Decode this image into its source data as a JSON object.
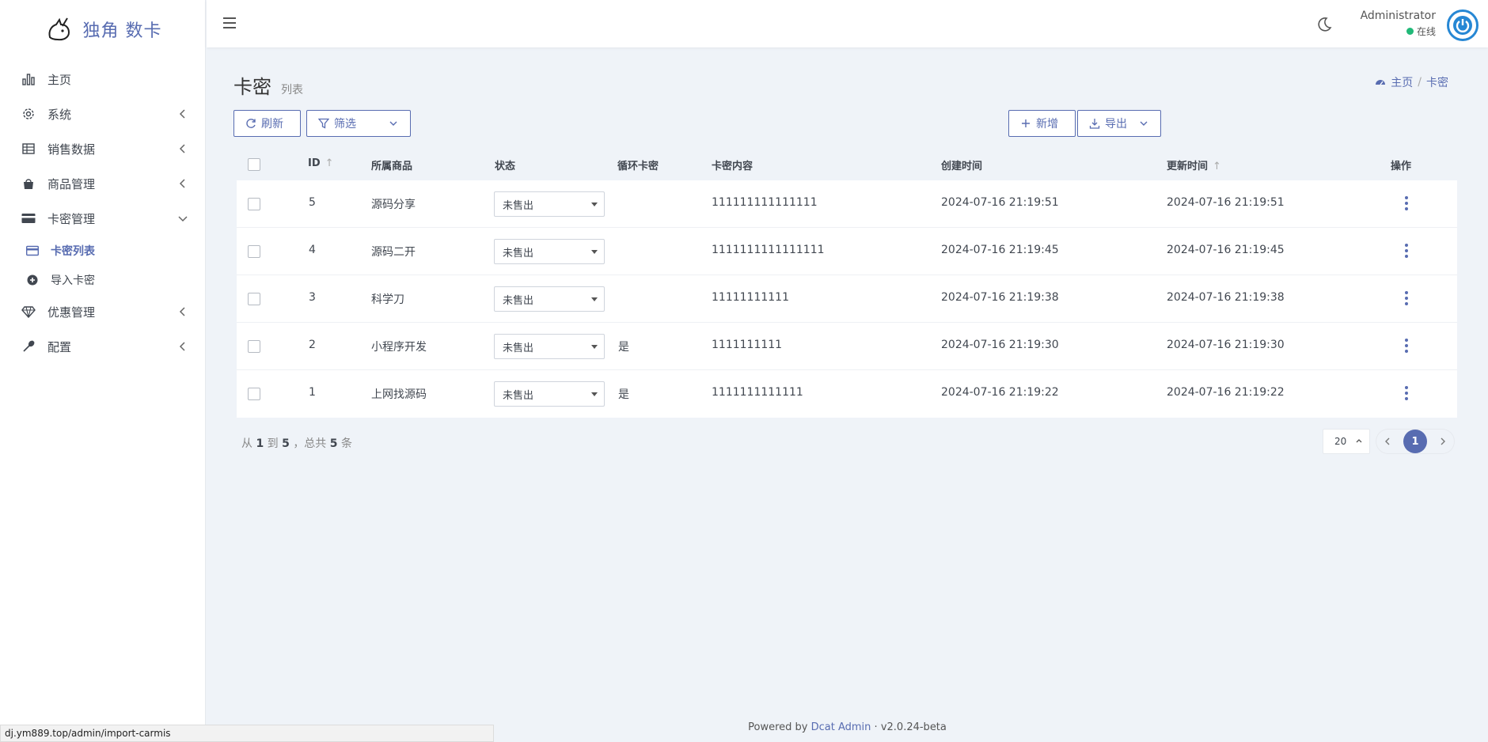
{
  "brand": {
    "name": "独角 数卡"
  },
  "sidebar": {
    "items": [
      {
        "label": "主页",
        "icon": "bar-chart-icon",
        "has_children": false
      },
      {
        "label": "系统",
        "icon": "gear-icon",
        "has_children": true
      },
      {
        "label": "销售数据",
        "icon": "table-icon",
        "has_children": true
      },
      {
        "label": "商品管理",
        "icon": "shopping-bag-icon",
        "has_children": true
      },
      {
        "label": "卡密管理",
        "icon": "credit-card-icon",
        "has_children": true,
        "expanded": true
      },
      {
        "label": "优惠管理",
        "icon": "diamond-icon",
        "has_children": true
      },
      {
        "label": "配置",
        "icon": "wrench-icon",
        "has_children": true
      }
    ],
    "submenu": [
      {
        "label": "卡密列表",
        "icon": "card-icon",
        "active": true
      },
      {
        "label": "导入卡密",
        "icon": "plus-circle-icon",
        "active": false
      }
    ]
  },
  "navbar": {
    "user_name": "Administrator",
    "user_status": "在线",
    "status_color": "#21b978"
  },
  "page": {
    "title": "卡密",
    "subtitle": "列表",
    "breadcrumb": {
      "home": "主页",
      "separator": "/",
      "current": "卡密"
    }
  },
  "toolbar": {
    "refresh_label": "刷新",
    "filter_label": "筛选",
    "add_label": "新增",
    "export_label": "导出"
  },
  "table": {
    "columns": [
      "ID",
      "所属商品",
      "状态",
      "循环卡密",
      "卡密内容",
      "创建时间",
      "更新时间",
      "操作"
    ],
    "rows": [
      {
        "id": "5",
        "product": "源码分享",
        "status": "未售出",
        "loop": "",
        "content": "111111111111111",
        "created": "2024-07-16 21:19:51",
        "updated": "2024-07-16 21:19:51"
      },
      {
        "id": "4",
        "product": "源码二开",
        "status": "未售出",
        "loop": "",
        "content": "1111111111111111",
        "created": "2024-07-16 21:19:45",
        "updated": "2024-07-16 21:19:45"
      },
      {
        "id": "3",
        "product": "科学刀",
        "status": "未售出",
        "loop": "",
        "content": "11111111111",
        "created": "2024-07-16 21:19:38",
        "updated": "2024-07-16 21:19:38"
      },
      {
        "id": "2",
        "product": "小程序开发",
        "status": "未售出",
        "loop": "是",
        "content": "1111111111",
        "created": "2024-07-16 21:19:30",
        "updated": "2024-07-16 21:19:30"
      },
      {
        "id": "1",
        "product": "上网找源码",
        "status": "未售出",
        "loop": "是",
        "content": "1111111111111",
        "created": "2024-07-16 21:19:22",
        "updated": "2024-07-16 21:19:22"
      }
    ]
  },
  "pager": {
    "prefix": "从",
    "from": "1",
    "mid1": "到",
    "to": "5",
    "mid2": "，总共",
    "total": "5",
    "suffix": "条",
    "per_page": "20",
    "current_page": "1"
  },
  "footer": {
    "powered": "Powered by",
    "link": "Dcat Admin",
    "dot": "·",
    "version": "v2.0.24-beta"
  },
  "statusbar": {
    "url": "dj.ym889.top/admin/import-carmis"
  },
  "colors": {
    "accent": "#586cb1",
    "background": "#eff3f8"
  }
}
